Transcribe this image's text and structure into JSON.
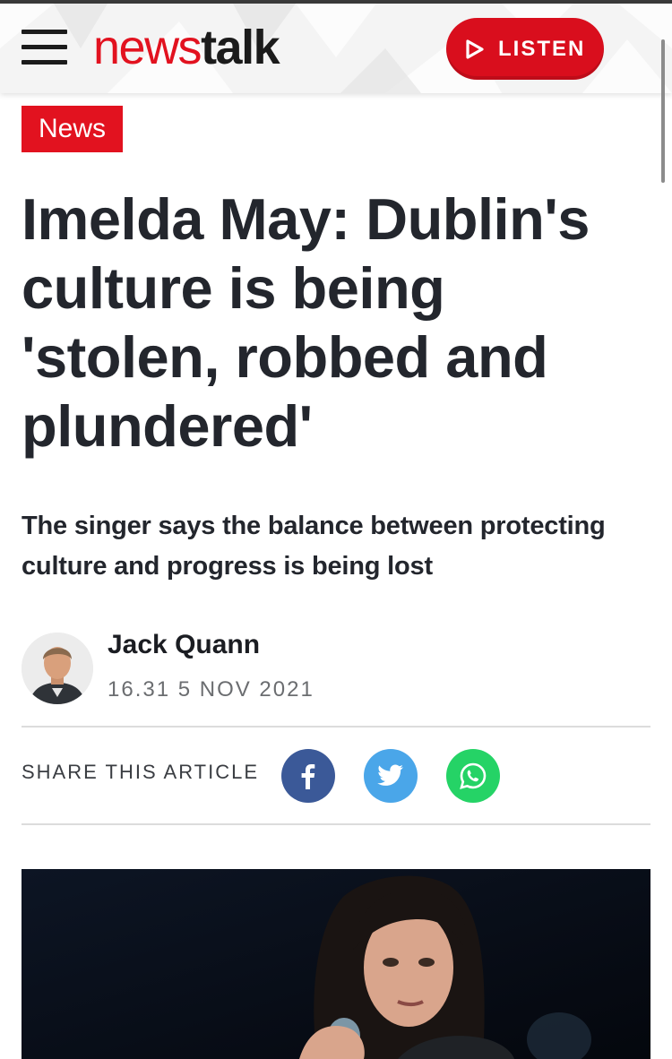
{
  "header": {
    "logo_part1": "news",
    "logo_part2": "talk",
    "listen_label": "LISTEN",
    "brand_color": "#e2121f"
  },
  "article": {
    "category": "News",
    "headline": "Imelda May: Dublin's culture is being 'stolen, robbed and plundered'",
    "subheadline": "The singer says the balance between protecting culture and progress is being lost",
    "author": "Jack Quann",
    "date": "16.31 5 NOV 2021"
  },
  "share": {
    "label": "SHARE THIS ARTICLE",
    "icons": [
      "facebook-icon",
      "twitter-icon",
      "whatsapp-icon"
    ],
    "colors": {
      "facebook": "#3b5998",
      "twitter": "#4aa6e9",
      "whatsapp": "#25d366"
    }
  }
}
